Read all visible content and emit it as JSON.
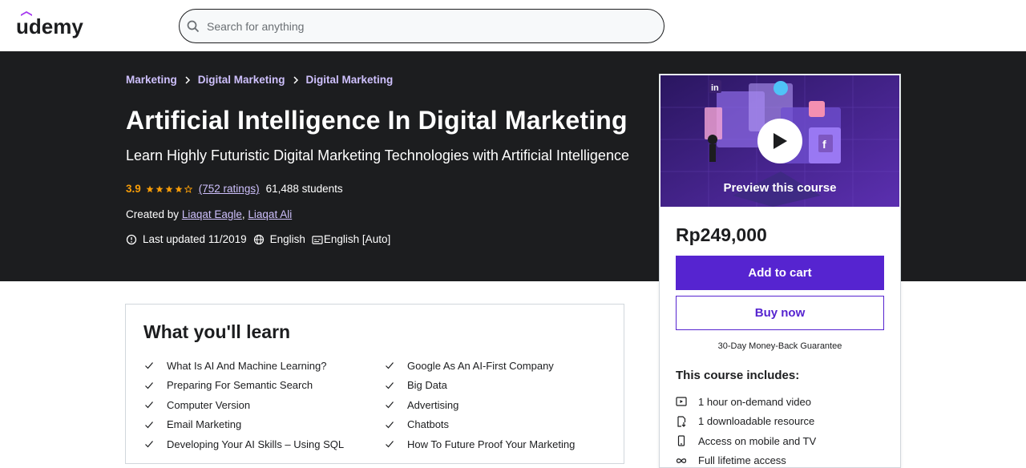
{
  "header": {
    "logo_text": "udemy",
    "search_placeholder": "Search for anything"
  },
  "breadcrumb": [
    "Marketing",
    "Digital Marketing",
    "Digital Marketing"
  ],
  "course": {
    "title": "Artificial Intelligence In Digital Marketing",
    "subtitle": "Learn Highly Futuristic Digital Marketing Technologies with Artificial Intelligence",
    "rating": "3.9",
    "rating_stars": 3.9,
    "ratings_count": "(752 ratings)",
    "students": "61,488 students",
    "created_by_label": "Created by",
    "instructors": [
      "Liaqat Eagle",
      "Liaqat Ali"
    ],
    "separator": ",",
    "last_updated": "Last updated 11/2019",
    "language": "English",
    "captions": "English [Auto]"
  },
  "sidebar": {
    "preview_label": "Preview this course",
    "price": "Rp249,000",
    "add_to_cart": "Add to cart",
    "buy_now": "Buy now",
    "guarantee": "30-Day Money-Back Guarantee",
    "includes_title": "This course includes:",
    "includes": [
      {
        "icon": "video-icon",
        "label": "1 hour on-demand video"
      },
      {
        "icon": "file-download-icon",
        "label": "1 downloadable resource"
      },
      {
        "icon": "mobile-icon",
        "label": "Access on mobile and TV"
      },
      {
        "icon": "infinity-icon",
        "label": "Full lifetime access"
      }
    ]
  },
  "learn": {
    "title": "What you'll learn",
    "left": [
      "What Is AI And Machine Learning?",
      "Preparing For Semantic Search",
      "Computer Version",
      "Email Marketing",
      "Developing Your AI Skills – Using SQL"
    ],
    "right": [
      "Google As An AI-First Company",
      "Big Data",
      "Advertising",
      "Chatbots",
      "How To Future Proof Your Marketing"
    ]
  },
  "colors": {
    "brand_purple": "#5624d0",
    "link_lavender": "#cec0fc",
    "star_orange": "#f69c08",
    "hero_bg": "#1c1d1f"
  }
}
